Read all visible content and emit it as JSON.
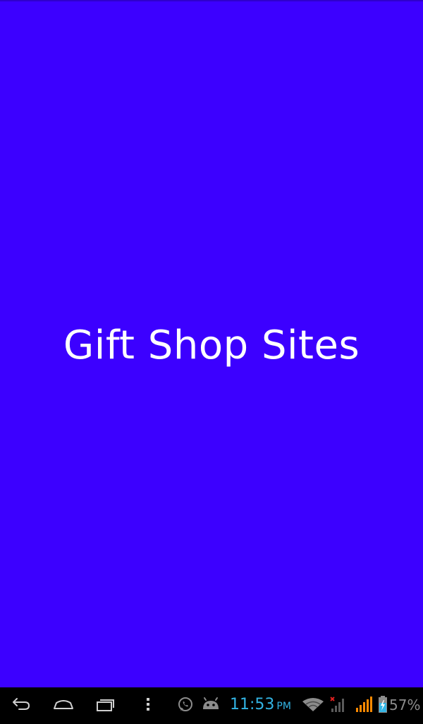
{
  "app": {
    "title": "Gift Shop Sites",
    "background_color": "#3c00ff",
    "text_color": "#ffffff"
  },
  "system_bar": {
    "navigation": [
      {
        "name": "back-icon"
      },
      {
        "name": "home-icon"
      },
      {
        "name": "recent-apps-icon"
      },
      {
        "name": "menu-overflow-icon"
      }
    ],
    "notifications": [
      "whatsapp-icon",
      "android-debug-icon"
    ],
    "time": "11:53",
    "ampm": "PM",
    "wifi": "wifi-icon",
    "signal_sim1": "signal-no-service-icon",
    "signal_sim2": "signal-full-icon",
    "battery_icon": "battery-charging-icon",
    "battery_percent": "57%",
    "clock_color": "#33b5e5",
    "signal_color": "#ff8a00"
  }
}
